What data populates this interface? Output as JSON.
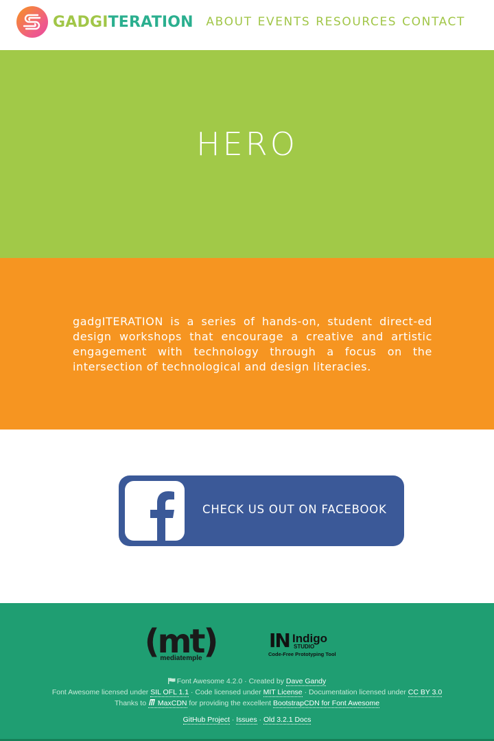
{
  "brand": {
    "name_part1": "GADGI",
    "name_part2": "TERATION",
    "logo_icon": "gadgiteration-logo-icon",
    "colors": {
      "green": "#a1c948",
      "teal": "#2baf8f",
      "orange": "#f69521",
      "pink": "#ef5b8a"
    }
  },
  "nav": {
    "items": [
      {
        "label": "ABOUT"
      },
      {
        "label": "EVENTS"
      },
      {
        "label": "RESOURCES"
      },
      {
        "label": "CONTACT"
      }
    ]
  },
  "hero": {
    "title": "HERO"
  },
  "about": {
    "text": "gadgITERATION is a series of hands-on, student direct-ed design workshops that encourage a creative and artistic engagement with technology through a focus on the intersection of technological and design literacies."
  },
  "facebook": {
    "label": "CHECK US OUT ON FACEBOOK",
    "icon": "facebook-icon",
    "color": "#3b5998"
  },
  "footer": {
    "sponsors": {
      "mediatemple_mark": "(mt)",
      "mediatemple_name": "mediatemple",
      "indigo_mark": "IN",
      "indigo_name": "Indigo",
      "indigo_studio": "STUDIO",
      "indigo_tagline": "Code-Free Prototyping Tool"
    },
    "line1": {
      "prefix": "Font Awesome 4.2.0 · Created by",
      "author": "Dave Gandy"
    },
    "line2": {
      "t1": "Font Awesome licensed under",
      "l1": "SIL OFL 1.1",
      "t2": "· Code licensed under",
      "l2": "MIT License",
      "t3": "· Documentation licensed under",
      "l3": "CC BY 3.0"
    },
    "line3": {
      "t1": "Thanks to",
      "l1": "MaxCDN",
      "t2": "for providing the excellent",
      "l2": "BootstrapCDN for Font Awesome"
    },
    "links": [
      {
        "label": "GitHub Project"
      },
      {
        "label": "Issues"
      },
      {
        "label": "Old 3.2.1 Docs"
      }
    ],
    "separator": "·",
    "colors": {
      "background": "#1f9e72"
    }
  }
}
